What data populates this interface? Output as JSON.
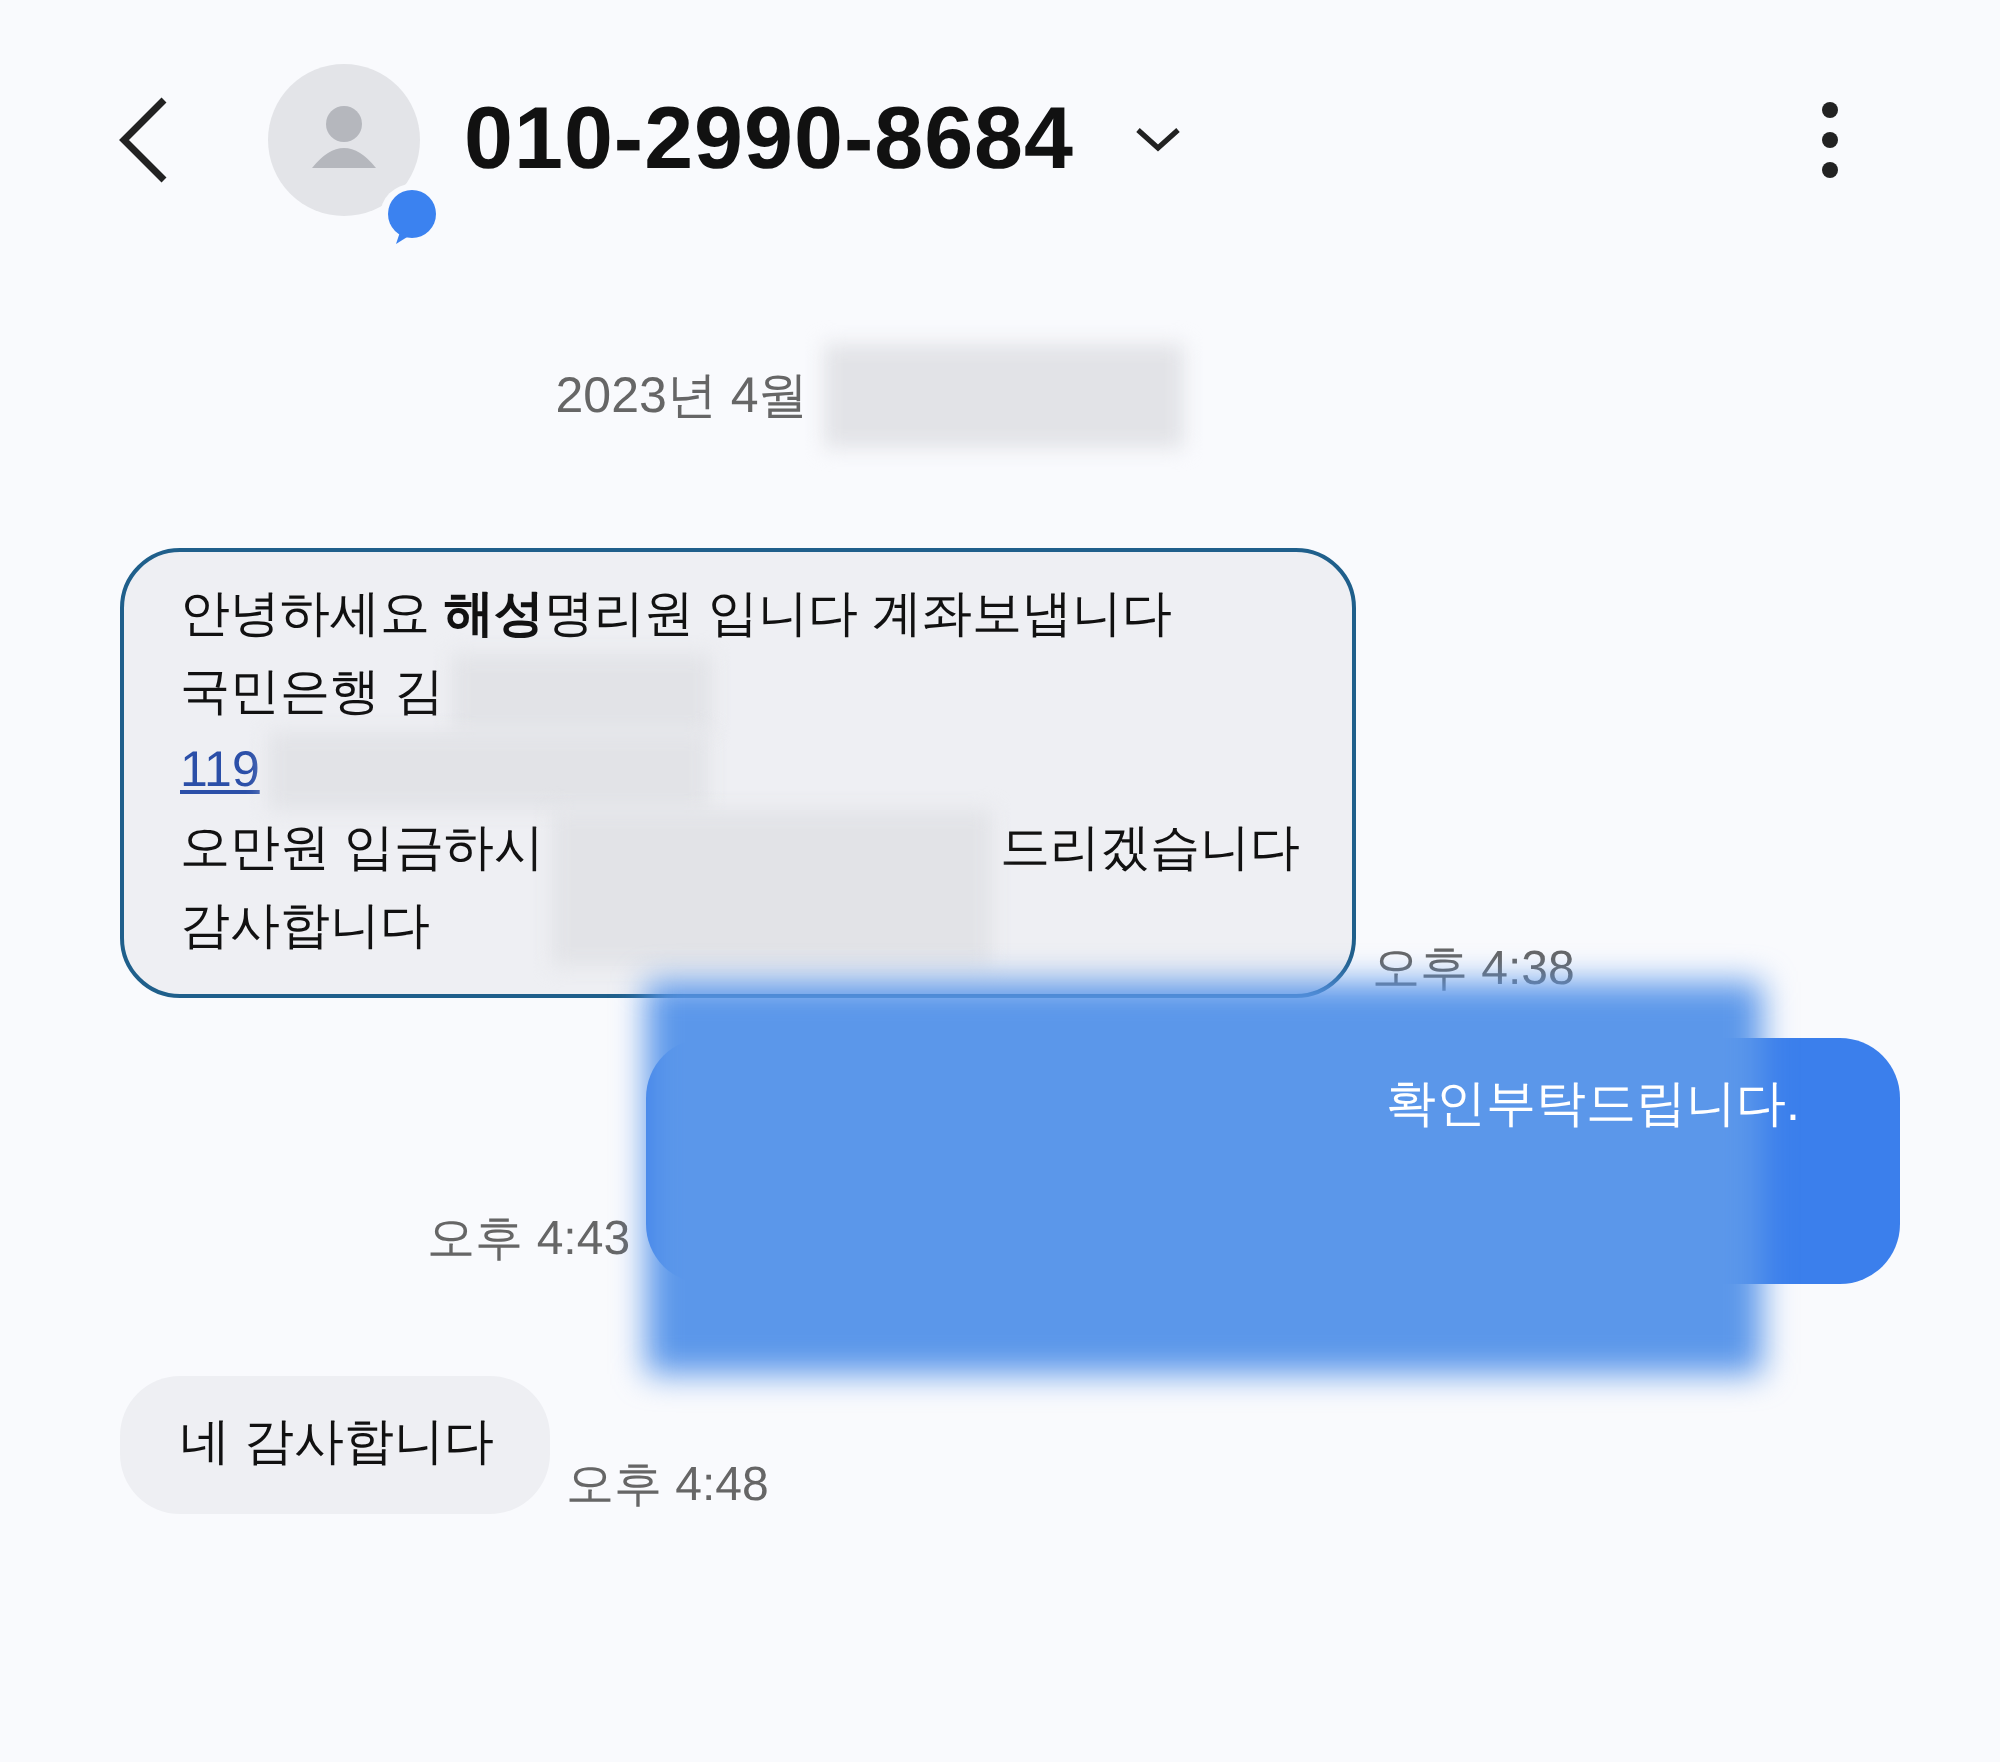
{
  "header": {
    "title": "010-2990-8684"
  },
  "date": {
    "text": "2023년 4월",
    "redacted": true
  },
  "messages": [
    {
      "kind": "incoming",
      "highlighted": true,
      "time": "오후 4:38",
      "lines": [
        [
          {
            "kind": "text",
            "text": "안녕하세요 **해성**명리원 입니다 계좌보냅니다"
          }
        ],
        [
          {
            "kind": "text",
            "text": "국민은행 김"
          },
          {
            "kind": "redacted"
          }
        ],
        [
          {
            "kind": "link",
            "text": "119"
          },
          {
            "kind": "redacted"
          }
        ],
        [
          {
            "kind": "text",
            "text": "오만원 입금하시"
          },
          {
            "kind": "redacted"
          },
          {
            "kind": "text",
            "text": "드리겠습니다"
          }
        ],
        [
          {
            "kind": "text",
            "text": "감사합니다"
          }
        ]
      ]
    },
    {
      "kind": "outgoing",
      "redacted": true,
      "time": "오후 4:43",
      "lines": [
        [
          {
            "kind": "text",
            "text": "확인부탁드립니다."
          }
        ]
      ]
    },
    {
      "kind": "incoming",
      "highlighted": false,
      "time": "오후 4:48",
      "lines": [
        [
          {
            "kind": "text",
            "text": "네 감사합니다"
          }
        ]
      ]
    }
  ]
}
